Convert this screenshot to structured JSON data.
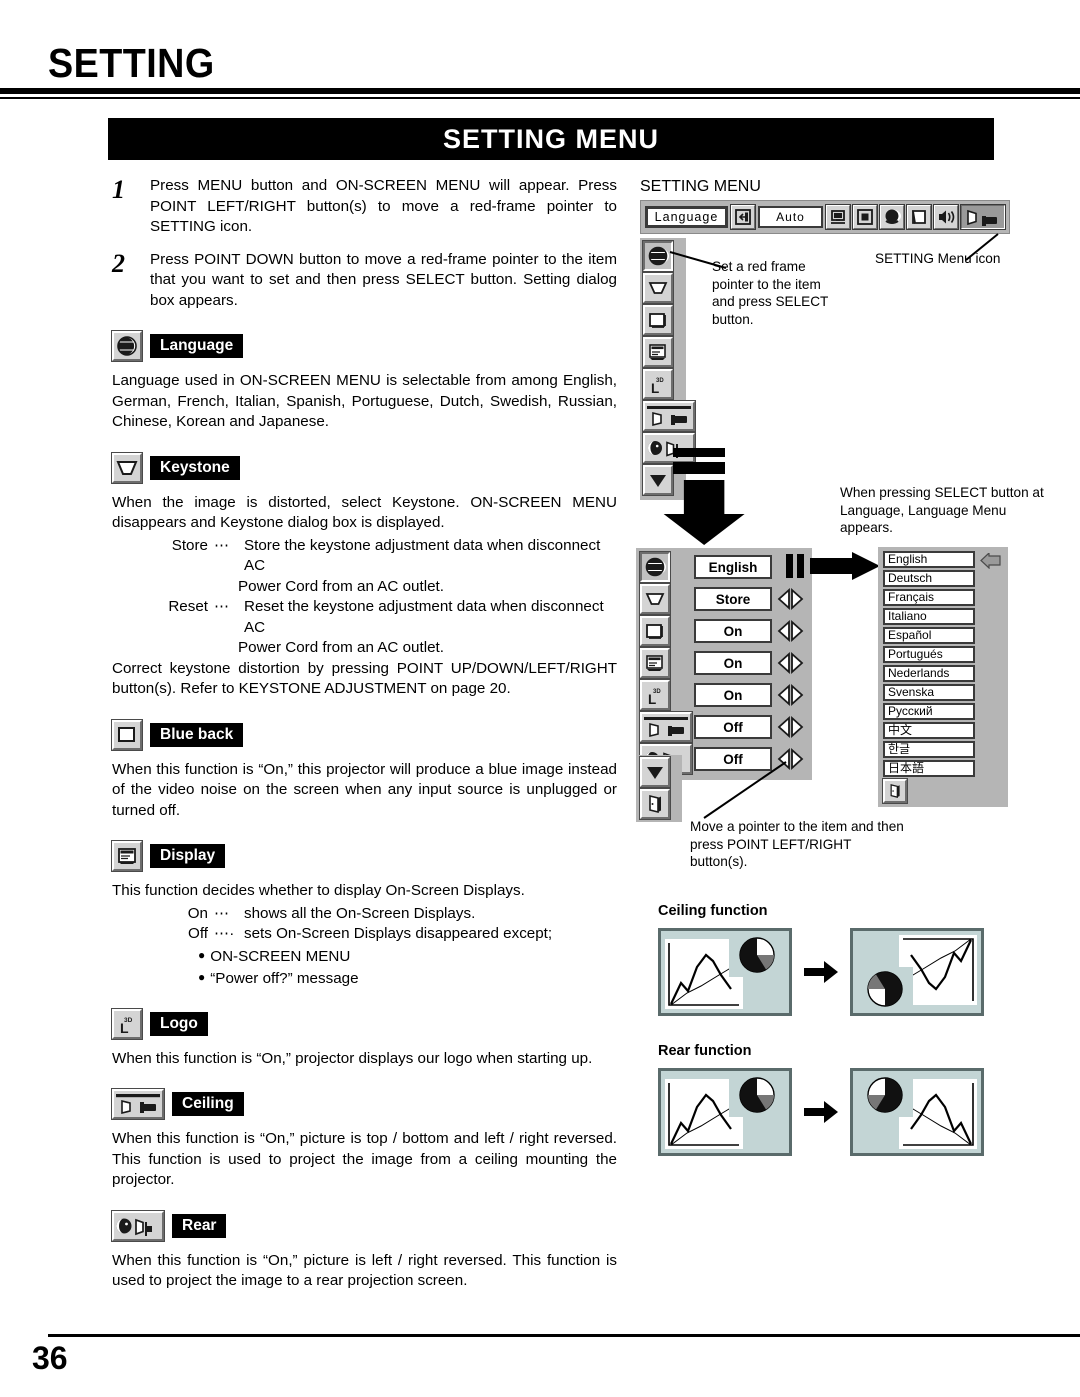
{
  "page": {
    "title": "SETTING",
    "banner": "SETTING MENU",
    "number": "36"
  },
  "steps": [
    {
      "num": "1",
      "text": "Press MENU button and ON-SCREEN MENU will appear.  Press POINT LEFT/RIGHT button(s) to move a red-frame pointer to SETTING icon."
    },
    {
      "num": "2",
      "text": "Press POINT DOWN button to move a red-frame pointer to the item that you want to set and then press SELECT button. Setting dialog box appears."
    }
  ],
  "sections": {
    "language": {
      "label": "Language",
      "body": "Language used in ON-SCREEN MENU is selectable from among English, German, French, Italian, Spanish, Portuguese, Dutch, Swedish, Russian, Chinese, Korean and Japanese."
    },
    "keystone": {
      "label": "Keystone",
      "body": "When the image is distorted, select Keystone.  ON-SCREEN MENU disappears and Keystone dialog box is displayed.",
      "store_key": "Store",
      "store_dots": "⋯",
      "store_val": "Store the keystone adjustment data when disconnect AC",
      "store_cont": "Power Cord from an AC outlet.",
      "reset_key": "Reset",
      "reset_dots": "⋯",
      "reset_val": "Reset the keystone adjustment data when disconnect AC",
      "reset_cont": "Power Cord from an AC outlet.",
      "tail": "Correct keystone distortion by pressing POINT UP/DOWN/LEFT/RIGHT button(s).   Refer to KEYSTONE ADJUSTMENT on page 20."
    },
    "blueback": {
      "label": "Blue back",
      "body": "When this function is “On,” this projector will produce a blue image instead of the video noise on the screen when any input source is unplugged or turned off."
    },
    "display": {
      "label": "Display",
      "body": "This function decides whether to display On-Screen Displays.",
      "on_key": "On",
      "on_dots": "⋯",
      "on_val": "shows all the On-Screen Displays.",
      "off_key": "Off",
      "off_dots": "⋯·",
      "off_val": "sets On-Screen Displays disappeared except;",
      "bullet1": "ON-SCREEN MENU",
      "bullet2": "“Power off?” message"
    },
    "logo": {
      "label": "Logo",
      "body": "When this function is “On,” projector displays our logo when starting up."
    },
    "ceiling": {
      "label": "Ceiling",
      "body": "When this function is “On,” picture is top / bottom and left / right reversed.  This function is used to project the image from a ceiling mounting the projector."
    },
    "rear": {
      "label": "Rear",
      "body": "When this function is “On,” picture is left / right reversed.  This function is used to project the image to a rear projection screen."
    }
  },
  "osd": {
    "heading": "SETTING MENU",
    "menubar": {
      "language_field": "Language",
      "auto_field": "Auto",
      "icons": [
        "input-icon",
        "pc-system-icon",
        "image-select-icon",
        "color-adjust-icon",
        "image-adjust-icon",
        "sound-icon",
        "setting-icon"
      ]
    },
    "callout_left": "Set a red frame pointer to the item and press SELECT button.",
    "callout_right": "SETTING Menu icon",
    "callout_select": "When pressing SELECT button at Language, Language Menu appears.",
    "callout_move": "Move a pointer to the item and then press POINT LEFT/RIGHT button(s).",
    "dialog_rows": [
      {
        "icon": "globe-icon",
        "value": "English",
        "has_arrows": false
      },
      {
        "icon": "keystone-icon",
        "value": "Store",
        "has_arrows": true
      },
      {
        "icon": "blueback-icon",
        "value": "On",
        "has_arrows": true
      },
      {
        "icon": "display-icon",
        "value": "On",
        "has_arrows": true
      },
      {
        "icon": "logo-icon",
        "value": "On",
        "has_arrows": true
      },
      {
        "icon": "ceiling-icon",
        "value": "Off",
        "has_arrows": true
      },
      {
        "icon": "rear-icon",
        "value": "Off",
        "has_arrows": true
      }
    ],
    "sidebar_icons": [
      "globe-icon",
      "keystone-icon",
      "blueback-icon",
      "display-icon",
      "logo-icon",
      "ceiling-icon",
      "rear-icon",
      "scroll-down-icon"
    ],
    "languages": [
      "English",
      "Deutsch",
      "Français",
      "Italiano",
      "Español",
      "Portugués",
      "Nederlands",
      "Svenska",
      "Русский",
      "中文",
      "한글",
      "日本語"
    ]
  },
  "illustrations": {
    "ceiling_title": "Ceiling function",
    "rear_title": "Rear function"
  }
}
